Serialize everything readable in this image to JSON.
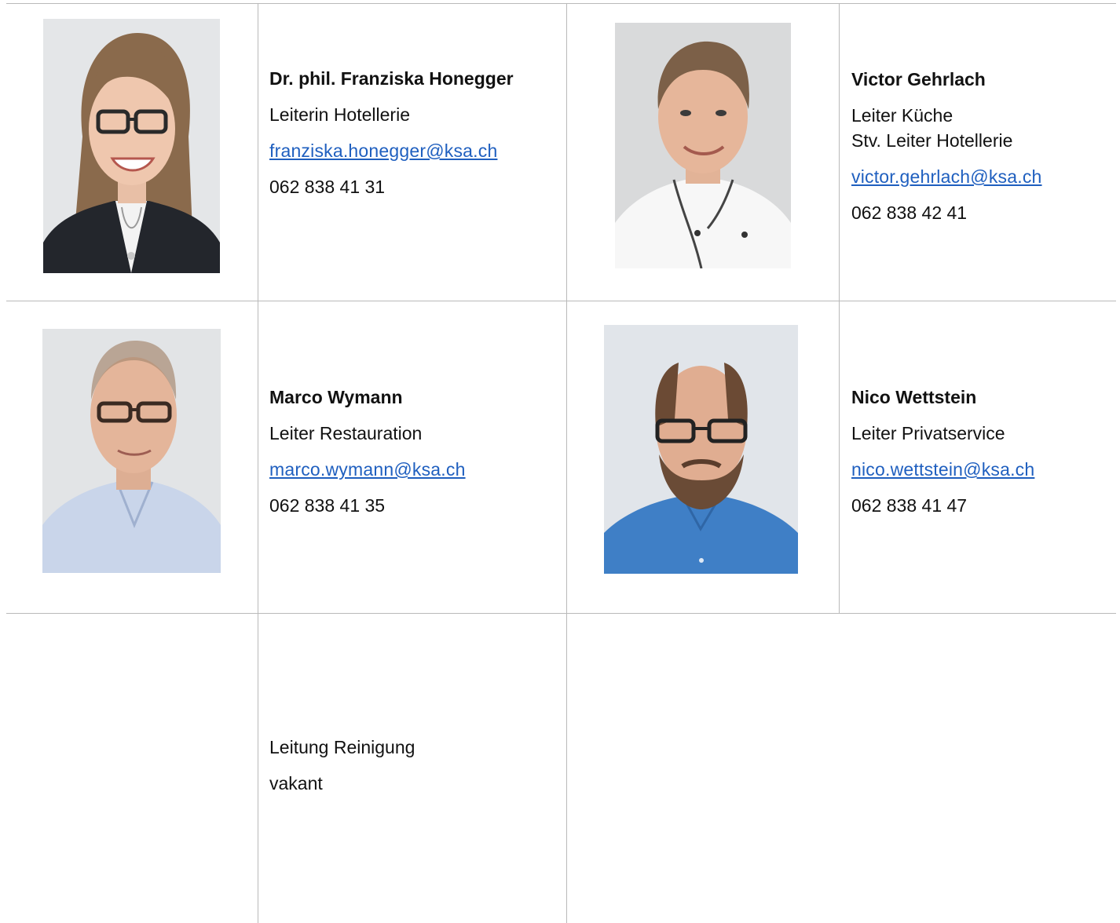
{
  "people": [
    {
      "name": "Dr. phil. Franziska Honegger",
      "role": "Leiterin Hotellerie",
      "email": "franziska.honegger@ksa.ch",
      "phone": "062 838 41 31",
      "photo": "portrait-photo"
    },
    {
      "name": "Victor Gehrlach",
      "role": "Leiter Küche",
      "role_line2": "Stv. Leiter Hotellerie",
      "email": "victor.gehrlach@ksa.ch",
      "phone": "062 838 42 41",
      "photo": "portrait-photo"
    },
    {
      "name": "Marco Wymann",
      "role": "Leiter Restauration",
      "email": "marco.wymann@ksa.ch",
      "phone": "062 838 41 35",
      "photo": "portrait-photo"
    },
    {
      "name": "Nico Wettstein",
      "role": "Leiter Privatservice",
      "email": "nico.wettstein@ksa.ch",
      "phone": "062 838 41 47",
      "photo": "portrait-photo"
    }
  ],
  "vacancy": {
    "role": "Leitung Reinigung",
    "status": "vakant"
  },
  "colors": {
    "link": "#1f5fbf",
    "grid_line": "#b9b9b9",
    "text": "#111111"
  }
}
